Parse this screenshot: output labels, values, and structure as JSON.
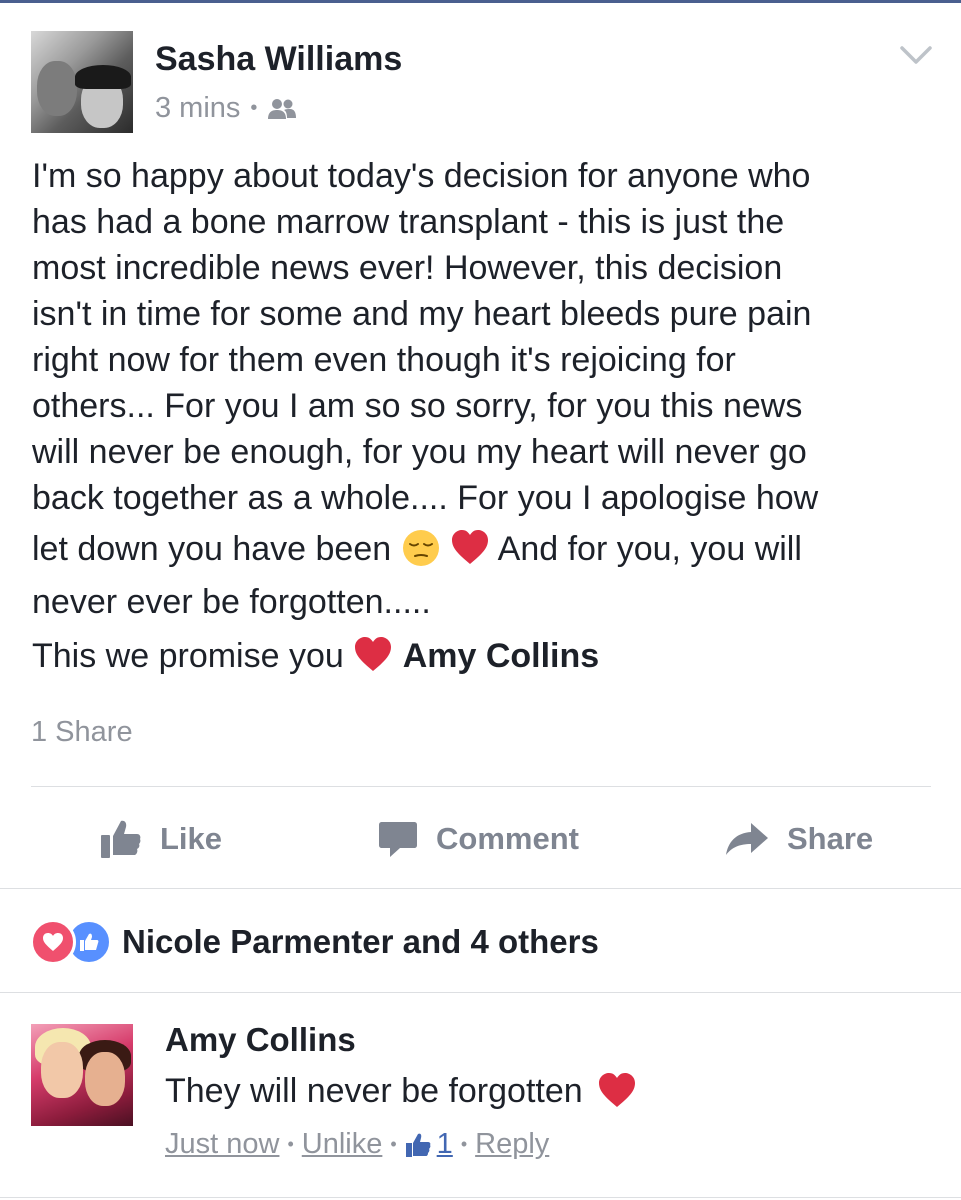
{
  "post": {
    "author": "Sasha Williams",
    "time": "3 mins",
    "audience_icon": "friends-icon",
    "body_lines": [
      "I'm so happy about today's decision for anyone who",
      "has had a bone marrow transplant - this is just the",
      "most incredible news ever! However, this decision",
      "isn't in time for some and my heart bleeds pure pain",
      "right now for them even though it's rejoicing for",
      "others... For you I am so so sorry, for you this news",
      "will never be enough, for you my heart will never go",
      "back together as a whole.... For you I apologise how"
    ],
    "line9_before": "let down you have been",
    "line9_after": "And for you, you will",
    "line10": "never ever be forgotten.....",
    "line11": "This we promise you",
    "mention": "Amy Collins",
    "shares": "1 Share"
  },
  "actions": {
    "like": "Like",
    "comment": "Comment",
    "share": "Share"
  },
  "reactions": {
    "summary": "Nicole Parmenter and 4 others"
  },
  "comment": {
    "author": "Amy Collins",
    "text": "They will never be forgotten",
    "time": "Just now",
    "unlike": "Unlike",
    "like_count": "1",
    "reply": "Reply"
  },
  "colors": {
    "accent": "#4267b2",
    "muted": "#90949c",
    "love": "#f0506e",
    "like": "#5890ff"
  }
}
